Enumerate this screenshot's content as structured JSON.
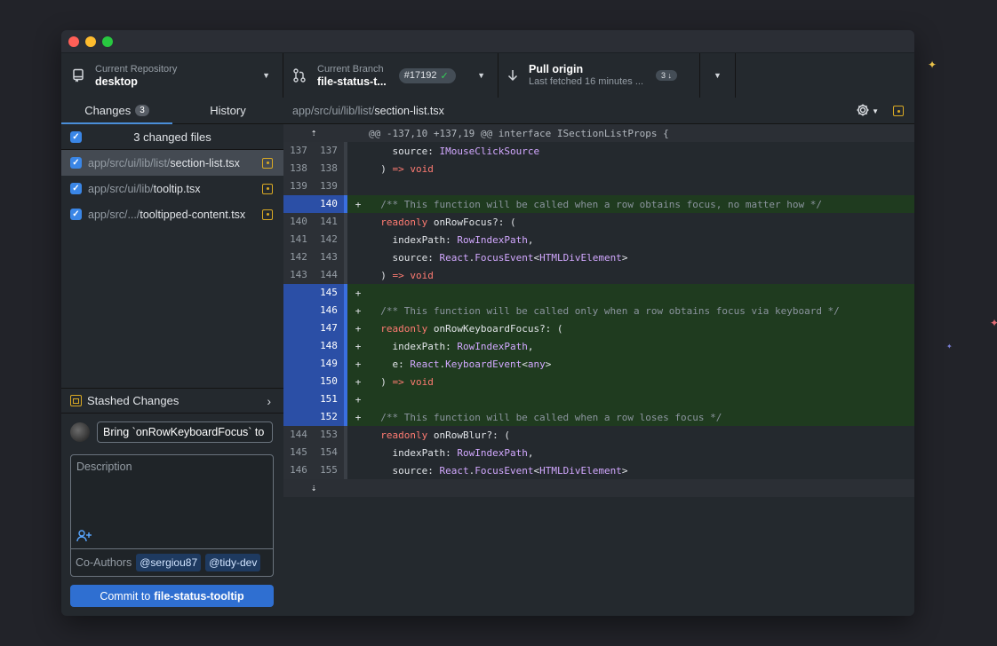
{
  "toolbar": {
    "repo": {
      "label": "Current Repository",
      "value": "desktop"
    },
    "branch": {
      "label": "Current Branch",
      "value": "file-status-t...",
      "pr": "#17192"
    },
    "pull": {
      "label": "Pull origin",
      "value": "Last fetched 16 minutes ...",
      "count": "3"
    }
  },
  "sidebar": {
    "tabs": [
      {
        "label": "Changes",
        "count": "3"
      },
      {
        "label": "History"
      }
    ],
    "files_header": "3 changed files",
    "files": [
      {
        "dir": "app/src/ui/lib/list/",
        "name": "section-list.tsx"
      },
      {
        "dir": "app/src/ui/lib/",
        "name": "tooltip.tsx"
      },
      {
        "dir": "app/src/.../",
        "name": "tooltipped-content.tsx"
      }
    ],
    "stashed": "Stashed Changes",
    "summary_value": "Bring `onRowKeyboardFocus` to",
    "description_placeholder": "Description",
    "coauthors_label": "Co-Authors",
    "coauthors": [
      "@sergiou87",
      "@tidy-dev"
    ],
    "commit_prefix": "Commit to",
    "commit_branch": "file-status-tooltip"
  },
  "diff": {
    "path_dir": "app/src/ui/lib/list/",
    "path_file": "section-list.tsx",
    "hunk_header": "@@ -137,10 +137,19 @@ interface ISectionListProps {",
    "lines": [
      {
        "type": "ctx",
        "old": "137",
        "new": "137",
        "code": "    source: IMouseClickSource"
      },
      {
        "type": "ctx",
        "old": "138",
        "new": "138",
        "code": "  ) => void"
      },
      {
        "type": "ctx",
        "old": "139",
        "new": "139",
        "code": ""
      },
      {
        "type": "add",
        "old": "",
        "new": "140",
        "code": "  /** This function will be called when a row obtains focus, no matter how */"
      },
      {
        "type": "ctx",
        "old": "140",
        "new": "141",
        "code": "  readonly onRowFocus?: ("
      },
      {
        "type": "ctx",
        "old": "141",
        "new": "142",
        "code": "    indexPath: RowIndexPath,"
      },
      {
        "type": "ctx",
        "old": "142",
        "new": "143",
        "code": "    source: React.FocusEvent<HTMLDivElement>"
      },
      {
        "type": "ctx",
        "old": "143",
        "new": "144",
        "code": "  ) => void"
      },
      {
        "type": "add",
        "old": "",
        "new": "145",
        "code": ""
      },
      {
        "type": "add",
        "old": "",
        "new": "146",
        "code": "  /** This function will be called only when a row obtains focus via keyboard */"
      },
      {
        "type": "add",
        "old": "",
        "new": "147",
        "code": "  readonly onRowKeyboardFocus?: ("
      },
      {
        "type": "add",
        "old": "",
        "new": "148",
        "code": "    indexPath: RowIndexPath,"
      },
      {
        "type": "add",
        "old": "",
        "new": "149",
        "code": "    e: React.KeyboardEvent<any>"
      },
      {
        "type": "add",
        "old": "",
        "new": "150",
        "code": "  ) => void"
      },
      {
        "type": "add",
        "old": "",
        "new": "151",
        "code": ""
      },
      {
        "type": "add",
        "old": "",
        "new": "152",
        "code": "  /** This function will be called when a row loses focus */"
      },
      {
        "type": "ctx",
        "old": "144",
        "new": "153",
        "code": "  readonly onRowBlur?: ("
      },
      {
        "type": "ctx",
        "old": "145",
        "new": "154",
        "code": "    indexPath: RowIndexPath,"
      },
      {
        "type": "ctx",
        "old": "146",
        "new": "155",
        "code": "    source: React.FocusEvent<HTMLDivElement>"
      }
    ]
  },
  "colors": {
    "accent": "#2f6fd1",
    "added": "#1f3b1f",
    "modified": "#d9a924"
  }
}
